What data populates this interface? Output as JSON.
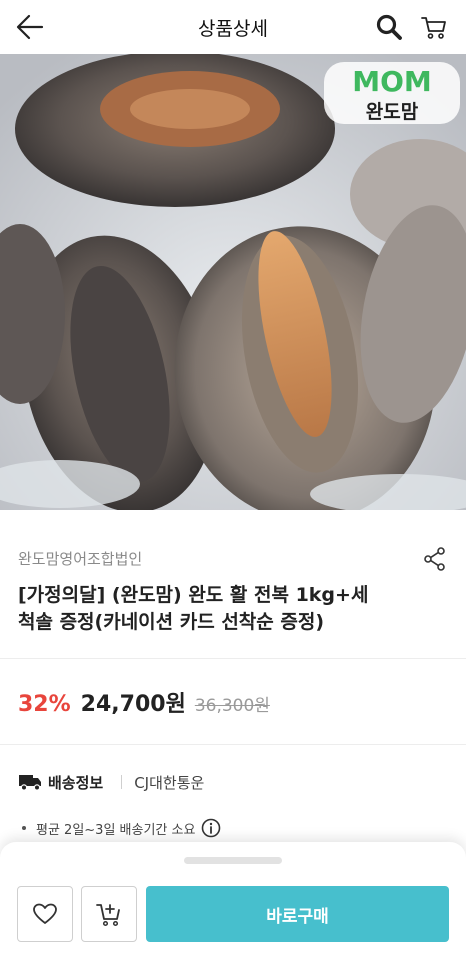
{
  "header": {
    "title": "상품상세",
    "back_icon": "back-arrow-icon",
    "search_icon": "search-icon",
    "cart_icon": "cart-icon"
  },
  "hero": {
    "brand_logo_text": "MOM",
    "brand_logo_subtext": "완도맘"
  },
  "product": {
    "seller": "완도맘영어조합법인",
    "title_line1": "[가정의달] (완도맘) 완도 활 전복 1kg+세",
    "title_line2": "척솔 증정(카네이션 카드 선착순 증정)",
    "discount": "32%",
    "price": "24,700원",
    "original_price": "36,300원"
  },
  "shipping": {
    "label": "배송정보",
    "carrier": "CJ대한통운",
    "note": "평균 2일~3일 배송기간 소요"
  },
  "bottom_bar": {
    "buy_label": "바로구매",
    "wish_icon": "heart-icon",
    "add_cart_icon": "add-cart-icon"
  },
  "colors": {
    "discount": "#e8453c",
    "buy_button": "#47bfcd",
    "logo_green": "#3fb85f",
    "logo_blue": "#27a8e0"
  }
}
